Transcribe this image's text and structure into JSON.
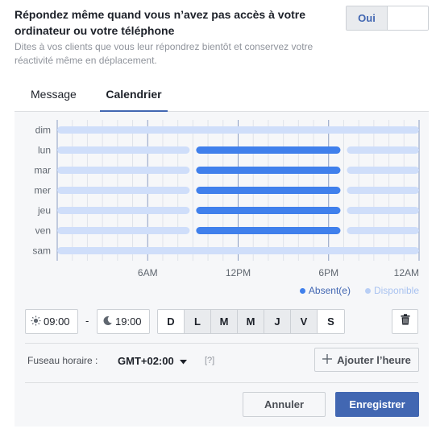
{
  "header": {
    "title": "Répondez même quand vous n’avez pas accès à votre ordinateur ou votre téléphone",
    "description": "Dites à vos clients que vous leur répondrez bientôt et conservez votre réactivité même en déplacement.",
    "toggle_on_label": "Oui"
  },
  "tabs": [
    {
      "label": "Message",
      "active": false
    },
    {
      "label": "Calendrier",
      "active": true
    }
  ],
  "chart_data": {
    "type": "timeline",
    "days": [
      "dim",
      "lun",
      "mar",
      "mer",
      "jeu",
      "ven",
      "sam"
    ],
    "x_ticks": [
      {
        "hour": 6,
        "label": "6AM"
      },
      {
        "hour": 12,
        "label": "12PM"
      },
      {
        "hour": 18,
        "label": "6PM"
      },
      {
        "hour": 24,
        "label": "12AM"
      }
    ],
    "x_range": [
      0,
      24
    ],
    "grid": true,
    "legend_placement": "bottom-right",
    "absent_ranges": [
      {
        "day": "lun",
        "start": 9,
        "end": 19
      },
      {
        "day": "mar",
        "start": 9,
        "end": 19
      },
      {
        "day": "mer",
        "start": 9,
        "end": 19
      },
      {
        "day": "jeu",
        "start": 9,
        "end": 19
      },
      {
        "day": "ven",
        "start": 9,
        "end": 19
      }
    ],
    "series": [
      {
        "name": "Absent(e)",
        "color": "#4080ec"
      },
      {
        "name": "Disponible",
        "color": "#cfdefa"
      }
    ]
  },
  "time_range": {
    "start": "09:00",
    "separator": "-",
    "end": "19:00"
  },
  "weekday_buttons": [
    {
      "label": "D",
      "selected": false
    },
    {
      "label": "L",
      "selected": true
    },
    {
      "label": "M",
      "selected": true
    },
    {
      "label": "M",
      "selected": true
    },
    {
      "label": "J",
      "selected": true
    },
    {
      "label": "V",
      "selected": true
    },
    {
      "label": "S",
      "selected": false
    }
  ],
  "timezone": {
    "label": "Fuseau horaire :",
    "value": "GMT+02:00",
    "help": "[?]"
  },
  "buttons": {
    "add_hour": "Ajouter l’heure",
    "cancel": "Annuler",
    "save": "Enregistrer"
  },
  "colors": {
    "accent": "#4267b2",
    "absent": "#4080ec",
    "available": "#cfdefa"
  },
  "icons": {
    "start_time": "sun-icon",
    "end_time": "moon-icon",
    "delete": "trash-icon",
    "add": "plus-icon",
    "dropdown": "caret-down-icon"
  }
}
